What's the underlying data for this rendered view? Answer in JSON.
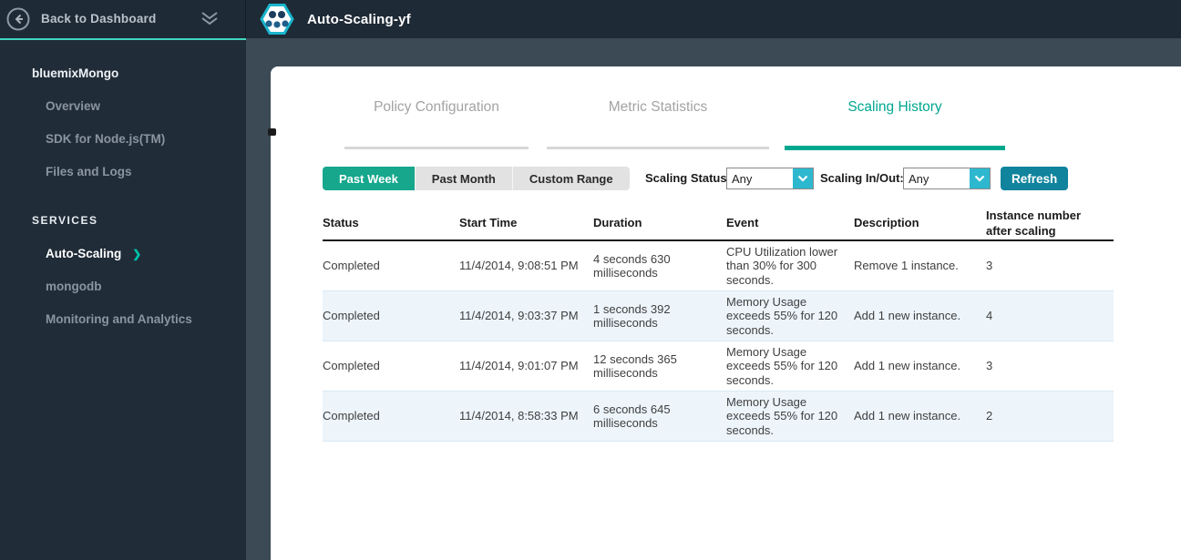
{
  "topbar": {
    "back_label": "Back to Dashboard",
    "app_title": "Auto-Scaling-yf"
  },
  "sidebar": {
    "app_name": "bluemixMongo",
    "app_items": [
      {
        "label": "Overview"
      },
      {
        "label": "SDK for Node.js(TM)"
      },
      {
        "label": "Files and Logs"
      }
    ],
    "services_heading": "SERVICES",
    "service_items": [
      {
        "label": "Auto-Scaling",
        "active": true,
        "chevron": "❯"
      },
      {
        "label": "mongodb",
        "active": false
      },
      {
        "label": "Monitoring and Analytics",
        "active": false
      }
    ]
  },
  "tabs": [
    {
      "label": "Policy Configuration",
      "active": false
    },
    {
      "label": "Metric Statistics",
      "active": false
    },
    {
      "label": "Scaling History",
      "active": true
    }
  ],
  "filters": {
    "range_buttons": [
      {
        "label": "Past Week",
        "active": true
      },
      {
        "label": "Past Month",
        "active": false
      },
      {
        "label": "Custom Range",
        "active": false
      }
    ],
    "scaling_status_label": "Scaling Status:",
    "scaling_status_value": "Any",
    "scaling_inout_label": "Scaling In/Out:",
    "scaling_inout_value": "Any",
    "refresh_label": "Refresh"
  },
  "table": {
    "columns": [
      "Status",
      "Start Time",
      "Duration",
      "Event",
      "Description",
      "Instance number after scaling"
    ],
    "rows": [
      {
        "status": "Completed",
        "start_time": "11/4/2014, 9:08:51 PM",
        "duration": "4 seconds 630 milliseconds",
        "event": "CPU Utilization lower than 30% for 300 seconds.",
        "description": "Remove 1 instance.",
        "instances": "3"
      },
      {
        "status": "Completed",
        "start_time": "11/4/2014, 9:03:37 PM",
        "duration": "1 seconds 392 milliseconds",
        "event": "Memory Usage exceeds 55% for 120 seconds.",
        "description": "Add 1 new instance.",
        "instances": "4"
      },
      {
        "status": "Completed",
        "start_time": "11/4/2014, 9:01:07 PM",
        "duration": "12 seconds 365 milliseconds",
        "event": "Memory Usage exceeds 55% for 120 seconds.",
        "description": "Add 1 new instance.",
        "instances": "3"
      },
      {
        "status": "Completed",
        "start_time": "11/4/2014, 8:58:33 PM",
        "duration": "6 seconds 645 milliseconds",
        "event": "Memory Usage exceeds 55% for 120 seconds.",
        "description": "Add 1 new instance.",
        "instances": "2"
      }
    ]
  },
  "colors": {
    "accent_teal": "#00a78f",
    "bright_teal_line": "#41d6bf",
    "active_button_teal": "#16a78c",
    "dropdown_cyan": "#2db8cf",
    "refresh_teal": "#10839d",
    "topbar_bg": "#1e2a36",
    "sidebar_bg": "#202c38",
    "content_strip_bg": "#3b4a54",
    "row_alt_bg": "#edf5fb"
  }
}
